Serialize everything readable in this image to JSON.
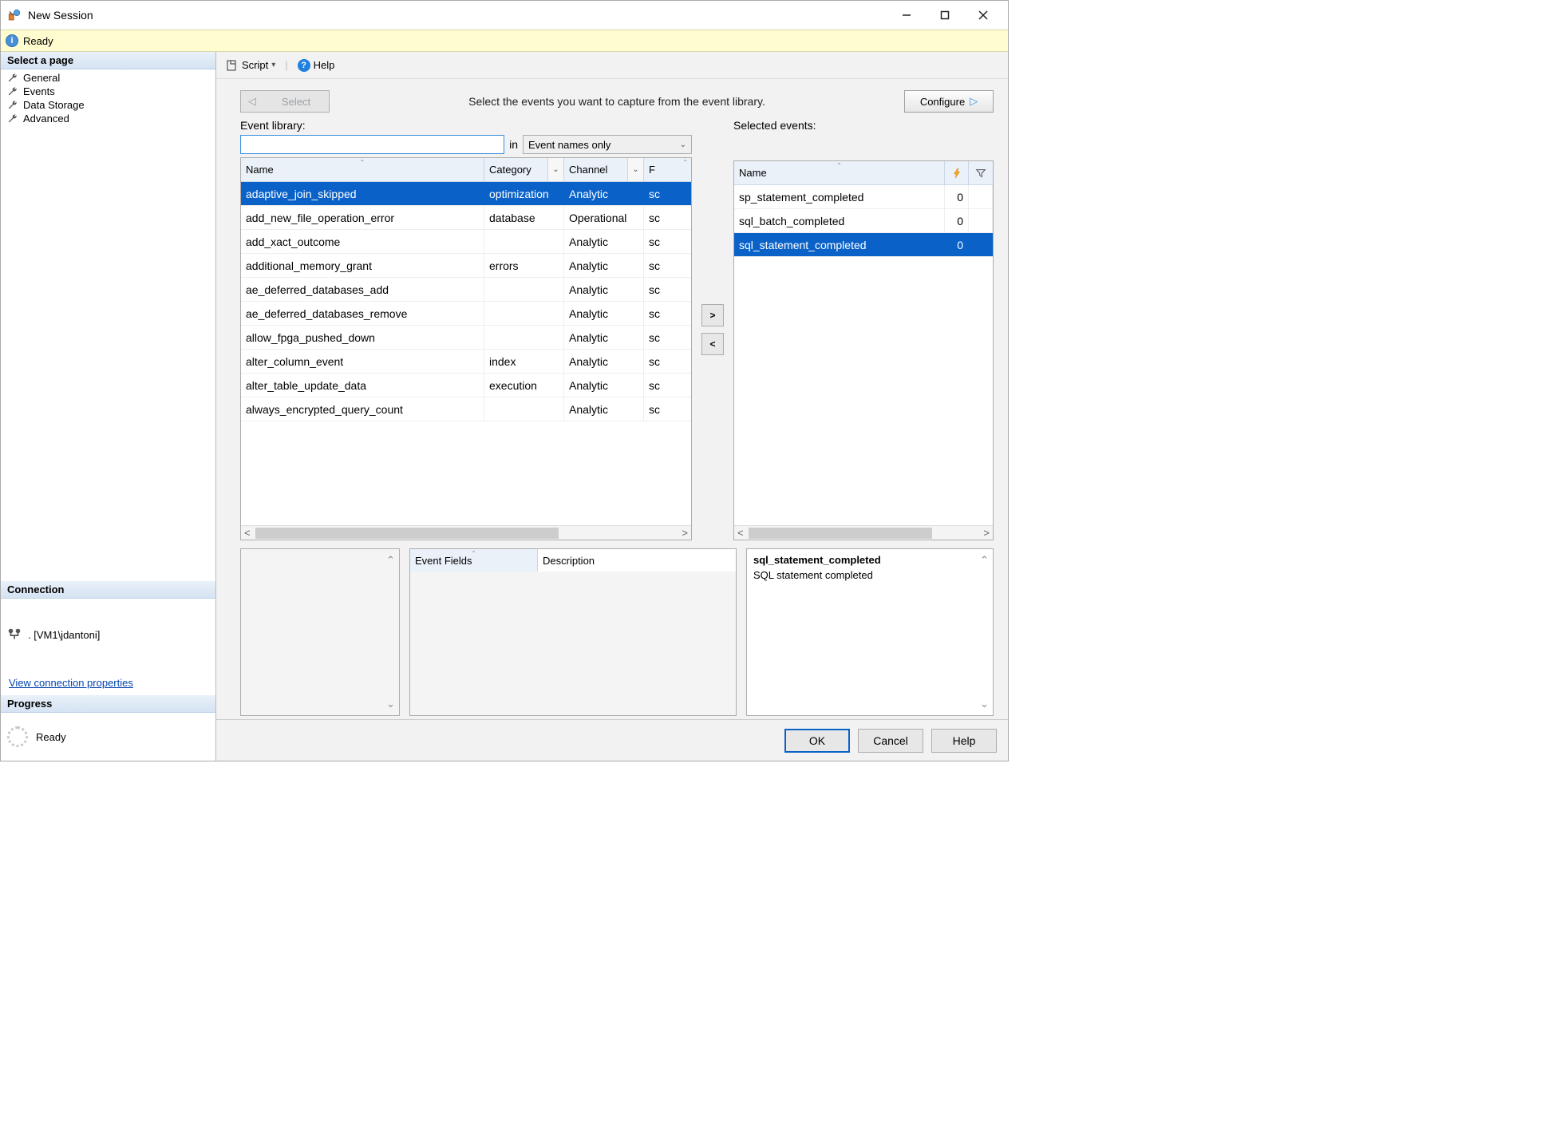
{
  "titlebar": {
    "title": "New Session"
  },
  "status": {
    "text": "Ready"
  },
  "pages": {
    "header": "Select a page",
    "items": [
      "General",
      "Events",
      "Data Storage",
      "Advanced"
    ]
  },
  "connection": {
    "header": "Connection",
    "value": ". [VM1\\jdantoni]",
    "link": "View connection properties"
  },
  "progress": {
    "header": "Progress",
    "value": "Ready"
  },
  "toolbar": {
    "script": "Script",
    "help": "Help"
  },
  "topctrl": {
    "select": "Select",
    "instruction": "Select the events you want to capture from the event library.",
    "configure": "Configure"
  },
  "library": {
    "label": "Event library:",
    "filter_value": "",
    "in": "in",
    "filter_mode": "Event names only",
    "columns": {
      "name": "Name",
      "category": "Category",
      "channel": "Channel",
      "extra": "F"
    },
    "rows": [
      {
        "name": "adaptive_join_skipped",
        "category": "optimization",
        "channel": "Analytic",
        "extra": "sc",
        "selected": true
      },
      {
        "name": "add_new_file_operation_error",
        "category": "database",
        "channel": "Operational",
        "extra": "sc"
      },
      {
        "name": "add_xact_outcome",
        "category": "",
        "channel": "Analytic",
        "extra": "sc"
      },
      {
        "name": "additional_memory_grant",
        "category": "errors",
        "channel": "Analytic",
        "extra": "sc"
      },
      {
        "name": "ae_deferred_databases_add",
        "category": "",
        "channel": "Analytic",
        "extra": "sc"
      },
      {
        "name": "ae_deferred_databases_remove",
        "category": "",
        "channel": "Analytic",
        "extra": "sc"
      },
      {
        "name": "allow_fpga_pushed_down",
        "category": "",
        "channel": "Analytic",
        "extra": "sc"
      },
      {
        "name": "alter_column_event",
        "category": "index",
        "channel": "Analytic",
        "extra": "sc"
      },
      {
        "name": "alter_table_update_data",
        "category": "execution",
        "channel": "Analytic",
        "extra": "sc"
      },
      {
        "name": "always_encrypted_query_count",
        "category": "",
        "channel": "Analytic",
        "extra": "sc"
      }
    ]
  },
  "selected_events": {
    "label": "Selected events:",
    "columns": {
      "name": "Name"
    },
    "rows": [
      {
        "name": "sp_statement_completed",
        "count": "0"
      },
      {
        "name": "sql_batch_completed",
        "count": "0"
      },
      {
        "name": "sql_statement_completed",
        "count": "0",
        "selected": true
      }
    ]
  },
  "fields": {
    "col1": "Event Fields",
    "col2": "Description"
  },
  "detail": {
    "title": "sql_statement_completed",
    "desc": "SQL statement completed"
  },
  "buttons": {
    "ok": "OK",
    "cancel": "Cancel",
    "help": "Help"
  }
}
